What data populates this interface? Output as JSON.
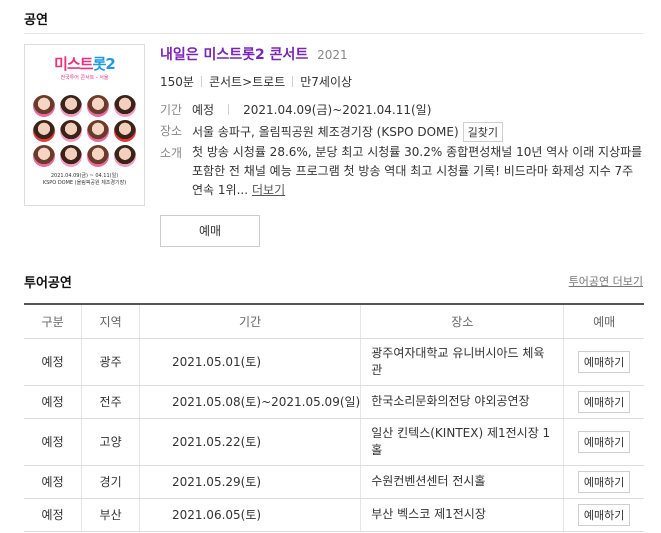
{
  "section": {
    "title": "공연"
  },
  "poster": {
    "logo_main": "미스트",
    "logo_accent": "롯2",
    "subtitle": "전국투어 콘서트 - 서울",
    "footer_line1": "2021.04.09(금) ~ 04.11(일)",
    "footer_line2": "KSPO DOME (올림픽공원 체조경기장)"
  },
  "concert": {
    "title": "내일은 미스트롯2 콘서트",
    "year": "2021",
    "runtime": "150분",
    "genre": "콘서트>트로트",
    "age": "만7세이상",
    "period_label": "기간",
    "period_status": "예정",
    "period_value": "2021.04.09(금)~2021.04.11(일)",
    "venue_label": "장소",
    "venue_value": "서울 송파구, 올림픽공원 체조경기장 (KSPO DOME)",
    "directions_button": "길찾기",
    "intro_label": "소개",
    "intro_text": "첫 방송 시청률 28.6%, 분당 최고 시청률 30.2% 종합편성채널 10년 역사 이래 지상파를 포함한 전 채널 예능 프로그램 첫 방송 역대 최고 시청률 기록! 비드라마 화제성 지수 7주 연속 1위...",
    "more_link": "더보기",
    "book_button": "예매"
  },
  "tour": {
    "title": "투어공연",
    "more_link": "투어공연 더보기",
    "columns": [
      "구분",
      "지역",
      "기간",
      "장소",
      "예매"
    ],
    "rows": [
      {
        "status": "예정",
        "region": "광주",
        "period": "2021.05.01(토)",
        "place": "광주여자대학교 유니버시아드 체육관",
        "action": "예매하기"
      },
      {
        "status": "예정",
        "region": "전주",
        "period": "2021.05.08(토)~2021.05.09(일)",
        "place": "한국소리문화의전당 야외공연장",
        "action": "예매하기"
      },
      {
        "status": "예정",
        "region": "고양",
        "period": "2021.05.22(토)",
        "place": "일산 킨텍스(KINTEX) 제1전시장 1홀",
        "action": "예매하기"
      },
      {
        "status": "예정",
        "region": "경기",
        "period": "2021.05.29(토)",
        "place": "수원컨벤션센터 전시홀",
        "action": "예매하기"
      },
      {
        "status": "예정",
        "region": "부산",
        "period": "2021.06.05(토)",
        "place": "부산 벡스코 제1전시장",
        "action": "예매하기"
      }
    ]
  },
  "colors": {
    "title_purple": "#7a25b6",
    "text": "#333333",
    "muted": "#888888"
  }
}
